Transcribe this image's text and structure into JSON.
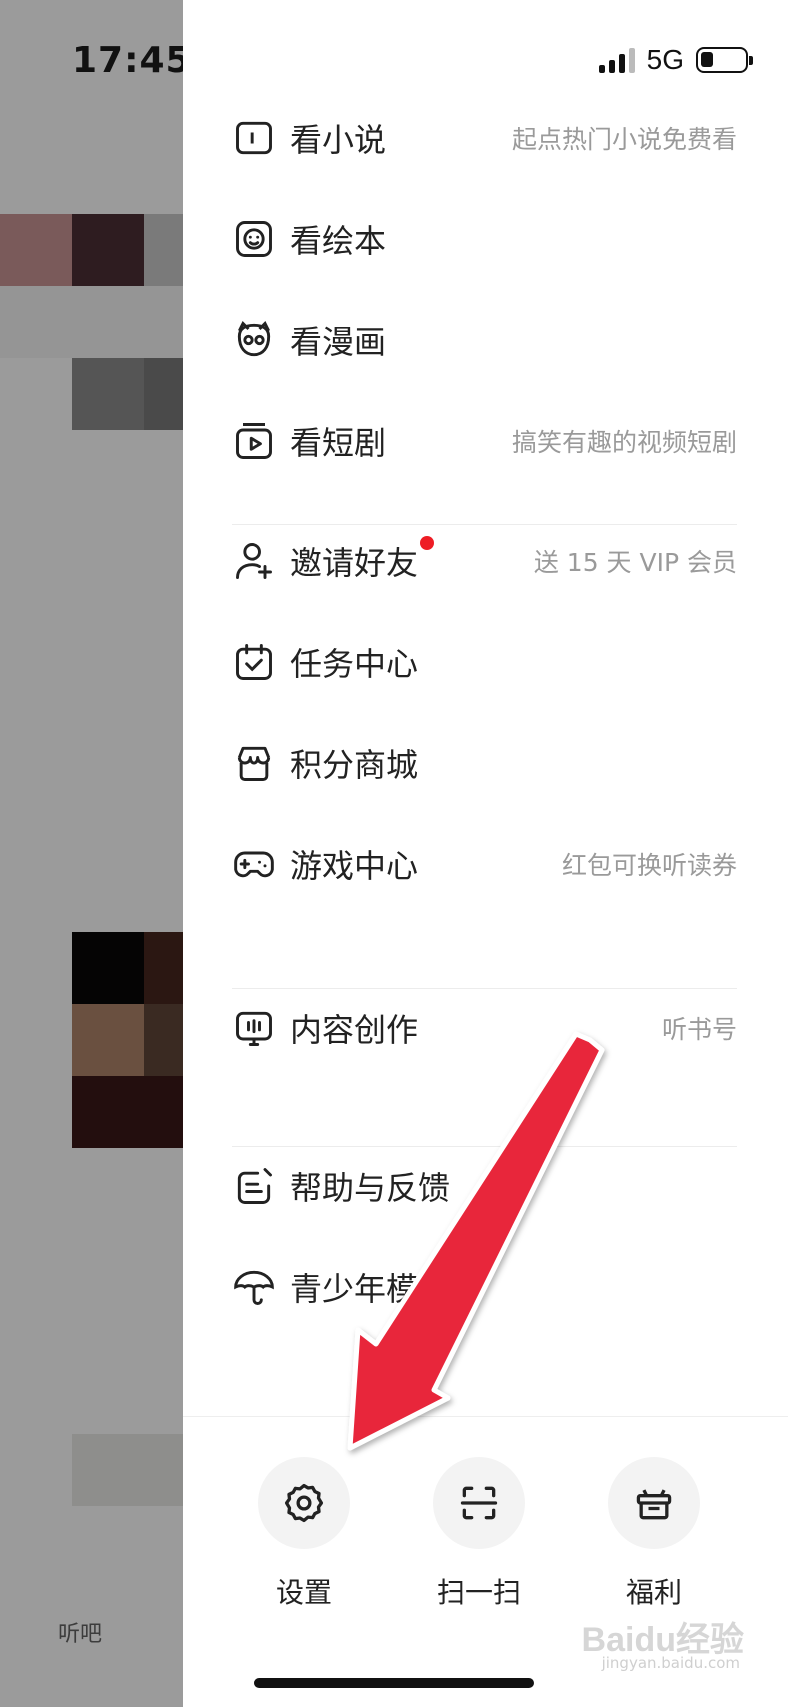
{
  "status_bar": {
    "time": "17:45",
    "network": "5G"
  },
  "background": {
    "tab_label": "听吧"
  },
  "menu_groups": [
    [
      {
        "label": "看小说",
        "hint": "起点热门小说免费看",
        "icon": "book-icon"
      },
      {
        "label": "看绘本",
        "hint": "",
        "icon": "picture-book-icon"
      },
      {
        "label": "看漫画",
        "hint": "",
        "icon": "comic-icon"
      },
      {
        "label": "看短剧",
        "hint": "搞笑有趣的视频短剧",
        "icon": "video-icon"
      }
    ],
    [
      {
        "label": "邀请好友",
        "hint": "送 15 天 VIP 会员",
        "icon": "add-user-icon",
        "badge": true
      },
      {
        "label": "任务中心",
        "hint": "",
        "icon": "calendar-check-icon"
      },
      {
        "label": "积分商城",
        "hint": "",
        "icon": "store-icon"
      },
      {
        "label": "游戏中心",
        "hint": "红包可换听读券",
        "icon": "gamepad-icon"
      }
    ],
    [
      {
        "label": "内容创作",
        "hint": "听书号",
        "icon": "creator-monitor-icon"
      }
    ],
    [
      {
        "label": "帮助与反馈",
        "hint": "",
        "icon": "feedback-icon"
      },
      {
        "label": "青少年模式",
        "hint": "",
        "icon": "umbrella-icon"
      }
    ]
  ],
  "bottom_actions": [
    {
      "label": "设置",
      "icon": "gear-icon"
    },
    {
      "label": "扫一扫",
      "icon": "scan-icon"
    },
    {
      "label": "福利",
      "icon": "gift-icon"
    }
  ],
  "watermark": {
    "brand": "Baidu经验",
    "url": "jingyan.baidu.com"
  },
  "colors": {
    "badge": "#ee1c25",
    "arrow": "#e8283b",
    "hint_text": "#9a9a9a"
  }
}
